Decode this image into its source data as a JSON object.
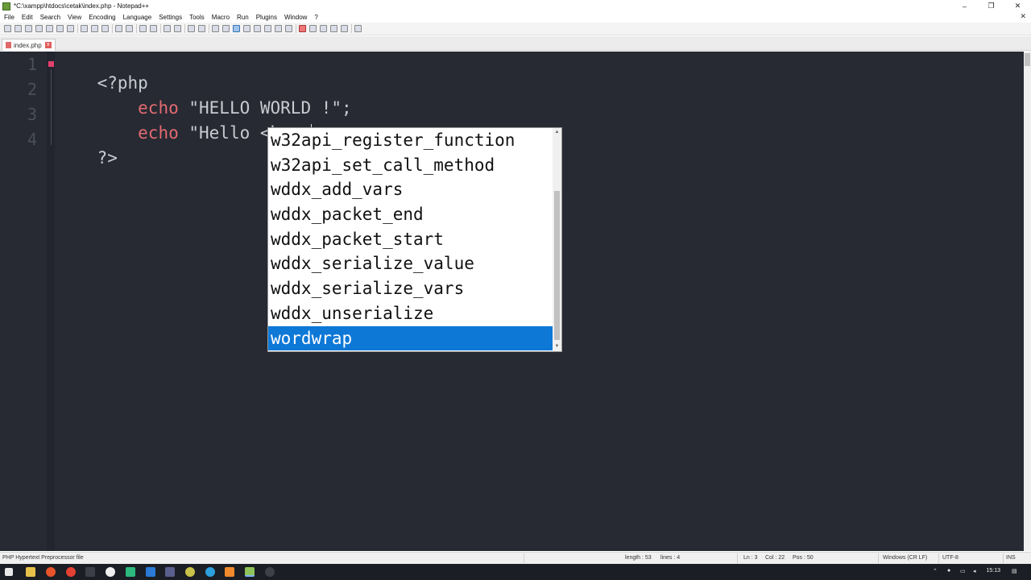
{
  "window": {
    "title": "*C:\\xampp\\htdocs\\cetak\\index.php - Notepad++",
    "controls": {
      "minimize": "–",
      "restore": "❐",
      "close": "✕"
    }
  },
  "menu": {
    "items": [
      "File",
      "Edit",
      "Search",
      "View",
      "Encoding",
      "Language",
      "Settings",
      "Tools",
      "Macro",
      "Run",
      "Plugins",
      "Window",
      "?"
    ],
    "close_glyph": "✕"
  },
  "tab": {
    "label": "index.php",
    "close_glyph": "x"
  },
  "editor": {
    "line_numbers": [
      "1",
      "2",
      "3",
      "4"
    ],
    "lines": [
      {
        "tokens": [
          {
            "text": "<?php",
            "style": "php-tag"
          }
        ]
      },
      {
        "tokens": [
          {
            "text": "    ",
            "style": "str"
          },
          {
            "text": "echo",
            "style": "kw"
          },
          {
            "text": " \"HELLO WORLD !\";",
            "style": "str"
          }
        ]
      },
      {
        "tokens": [
          {
            "text": "    ",
            "style": "str"
          },
          {
            "text": "echo",
            "style": "kw"
          },
          {
            "text": " \"Hello <b>wo",
            "style": "str"
          }
        ]
      },
      {
        "tokens": [
          {
            "text": "?>",
            "style": "php-tag"
          }
        ]
      }
    ]
  },
  "autocomplete": {
    "items": [
      "w32api_register_function",
      "w32api_set_call_method",
      "wddx_add_vars",
      "wddx_packet_end",
      "wddx_packet_start",
      "wddx_serialize_value",
      "wddx_serialize_vars",
      "wddx_unserialize",
      "wordwrap"
    ],
    "selected_index": 8,
    "selected_color": "#0e78d7"
  },
  "status": {
    "file_type": "PHP Hypertext Preprocessor file",
    "length": "length : 53",
    "lines": "lines : 4",
    "ln": "Ln : 3",
    "col": "Col : 22",
    "pos": "Pos : 50",
    "eol": "Windows (CR LF)",
    "encoding": "UTF-8",
    "mode": "INS"
  },
  "taskbar": {
    "clock": "15:13"
  },
  "colors": {
    "editor_bg": "#272a33",
    "keyword": "#e46a70",
    "text": "#c8cbd0",
    "line_number": "#4b4f59"
  }
}
